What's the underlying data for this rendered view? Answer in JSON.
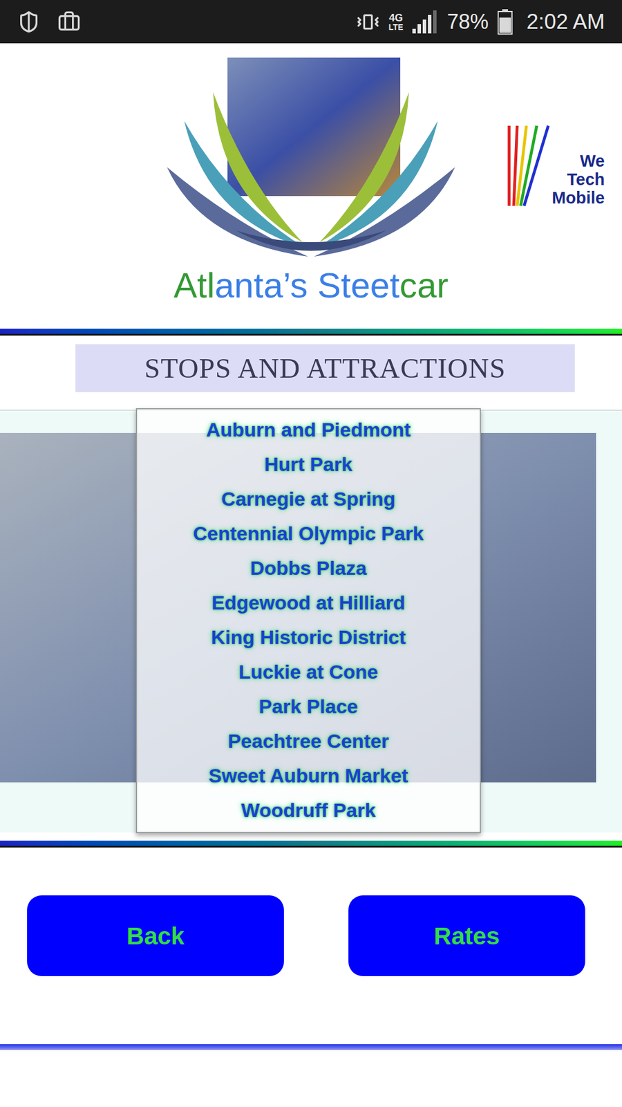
{
  "status_bar": {
    "network": "4G",
    "network_sub": "LTE",
    "signal_level": 0.8,
    "battery": "78%",
    "battery_level": 0.78,
    "time": "2:02 AM"
  },
  "header": {
    "title_segments": [
      {
        "text": "Atl",
        "color": "#339933"
      },
      {
        "text": "anta’s Steet",
        "color": "#3b7fe6"
      },
      {
        "text": "car",
        "color": "#339933"
      }
    ],
    "partner_logo": [
      "We",
      "Tech",
      "Mobile"
    ]
  },
  "section_title": "STOPS AND ATTRACTIONS",
  "stops": [
    "Auburn and Piedmont",
    "Hurt Park",
    "Carnegie at Spring",
    "Centennial Olympic Park",
    "Dobbs Plaza",
    "Edgewood at Hilliard",
    "King Historic District",
    "Luckie at Cone",
    "Park Place",
    "Peachtree Center",
    "Sweet Auburn Market",
    "Woodruff Park"
  ],
  "buttons": [
    "Back",
    "Rates"
  ]
}
